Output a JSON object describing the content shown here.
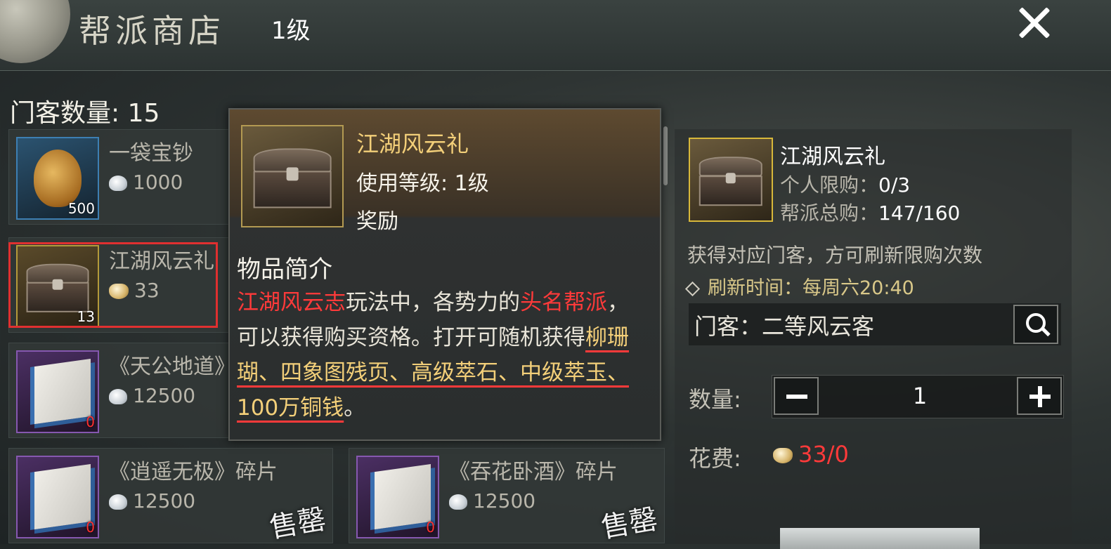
{
  "header": {
    "title": "帮派商店",
    "level": "1级"
  },
  "retainer_count": "门客数量: 15",
  "items": [
    {
      "name": "一袋宝钞",
      "price": "1000",
      "currency": "silver-coin-icon",
      "qty": "500",
      "icon": "money-bag-icon"
    },
    {
      "name": "江湖风云礼",
      "price": "33",
      "currency": "gold-ingot-icon",
      "qty": "13",
      "icon": "treasure-chest-icon",
      "selected": true
    },
    {
      "name": "《天公地道》",
      "price": "12500",
      "currency": "silver-ingot-icon",
      "qty": "0",
      "icon": "manual-book-icon"
    },
    {
      "name": "《逍遥无极》碎片",
      "price": "12500",
      "currency": "silver-ingot-icon",
      "qty": "0",
      "icon": "manual-book-icon",
      "sold_out": "售罄"
    },
    {
      "name": "《吞花卧酒》碎片",
      "price": "12500",
      "currency": "silver-ingot-icon",
      "qty": "0",
      "icon": "manual-book-icon",
      "sold_out": "售罄"
    }
  ],
  "tooltip": {
    "name": "江湖风云礼",
    "level": "使用等级: 1级",
    "type": "奖励",
    "desc_title": "物品简介",
    "desc_parts": [
      {
        "text": "江湖风云志",
        "style": "red"
      },
      {
        "text": "玩法中，各势力的",
        "style": "plain"
      },
      {
        "text": "头名帮派",
        "style": "red"
      },
      {
        "text": "，可以获得购买资格。打开可随机获得",
        "style": "plain"
      },
      {
        "text": "柳珊瑚、四象图残页、高级萃石、中级萃玉、100万铜钱",
        "style": "gold-underline"
      },
      {
        "text": "。",
        "style": "plain"
      }
    ]
  },
  "detail": {
    "name": "江湖风云礼",
    "personal_label": "个人限购：",
    "personal_value": "0/3",
    "guild_label": "帮派总购：",
    "guild_value": "147/160",
    "note": "获得对应门客，方可刷新限购次数",
    "refresh": "刷新时间：每周六20:40",
    "retainer_select": "门客：二等风云客",
    "quantity_label": "数量:",
    "quantity": "1",
    "cost_label": "花费:",
    "cost": "33/0"
  },
  "colors": {
    "accent_gold": "#f3cf79",
    "alert_red": "#ff3a3a",
    "selection_border": "#e03030"
  }
}
